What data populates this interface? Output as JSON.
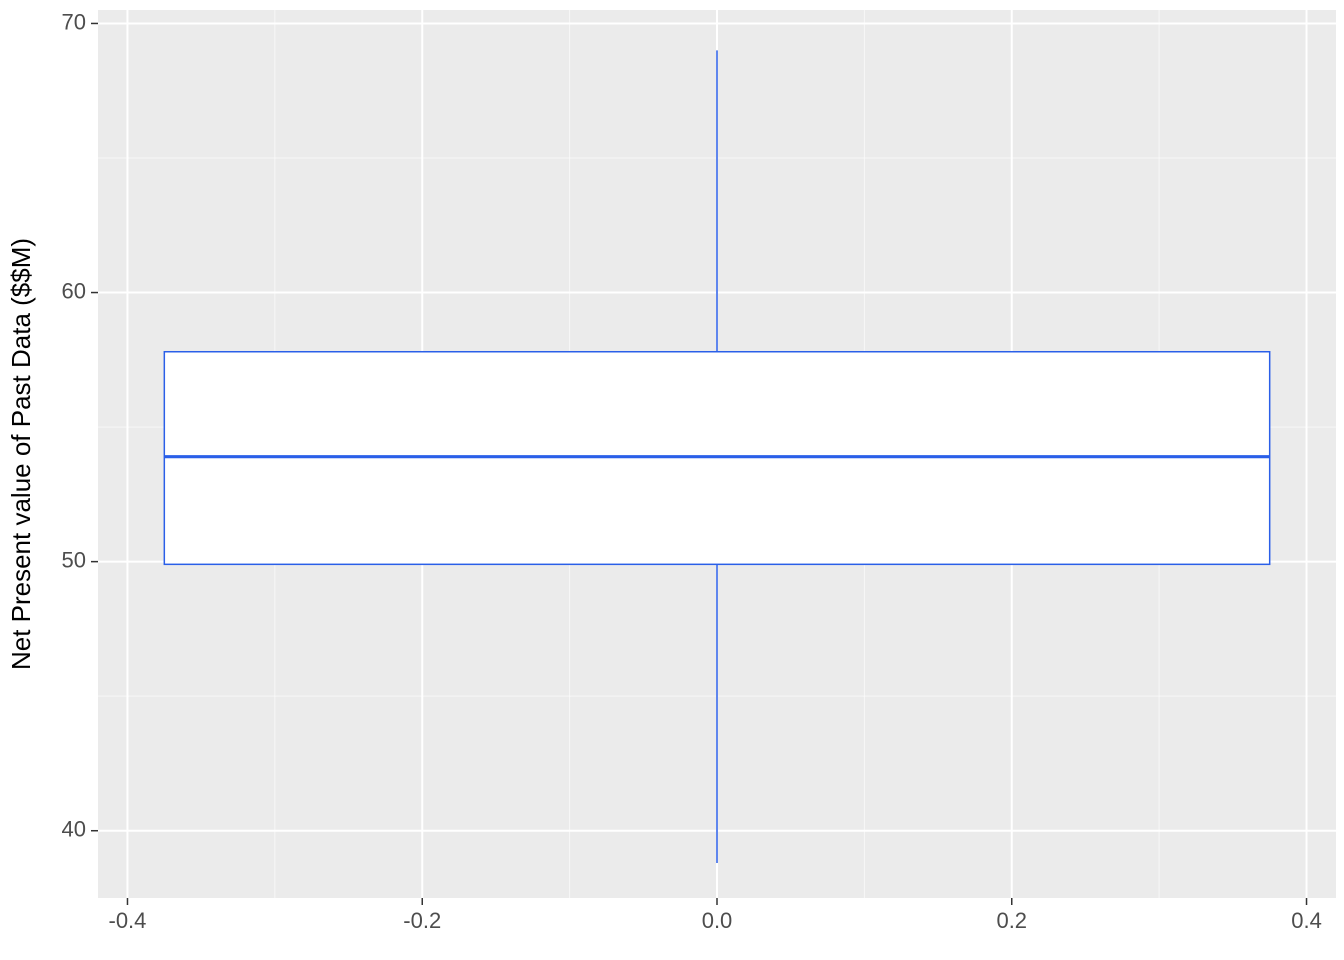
{
  "chart_data": {
    "type": "boxplot",
    "ylabel": "Net Present value of Past Data ($$M)",
    "xlabel": "",
    "x_ticks": [
      -0.4,
      -0.2,
      0.0,
      0.2,
      0.4
    ],
    "y_ticks": [
      40,
      50,
      60,
      70
    ],
    "xlim": [
      -0.42,
      0.42
    ],
    "ylim": [
      37.5,
      70.5
    ],
    "box": {
      "lower_whisker": 38.8,
      "q1": 49.9,
      "median": 53.9,
      "q3": 57.8,
      "upper_whisker": 69.0,
      "x_center": 0.0,
      "box_halfwidth": 0.375
    },
    "colors": {
      "panel_bg": "#EBEBEB",
      "grid": "#FFFFFF",
      "box_stroke": "#2A5FE8",
      "box_fill": "#FFFFFF"
    }
  },
  "ylabel_text": "Net Present value of Past Data ($$M)",
  "x_tick_labels": [
    "-0.4",
    "-0.2",
    "0.0",
    "0.2",
    "0.4"
  ],
  "y_tick_labels": [
    "40",
    "50",
    "60",
    "70"
  ]
}
